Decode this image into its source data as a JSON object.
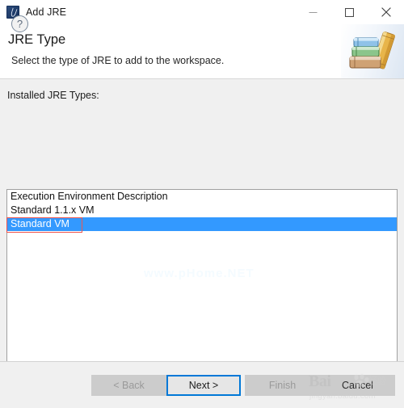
{
  "window": {
    "title": "Add JRE",
    "icon": "jre-icon",
    "controls": {
      "minimize": "minimize-icon",
      "maximize": "maximize-icon",
      "close": "close-icon"
    }
  },
  "header": {
    "title": "JRE Type",
    "subtitle": "Select the type of JRE to add to the workspace.",
    "banner_icon": "books-icon"
  },
  "main": {
    "list_label": "Installed JRE Types:",
    "list_items": [
      {
        "label": "Execution Environment Description",
        "selected": false
      },
      {
        "label": "Standard 1.1.x VM",
        "selected": false
      },
      {
        "label": "Standard VM",
        "selected": true
      }
    ],
    "selection_color": "#3399ff",
    "annotation_color": "#f0544c",
    "watermark": "www.pHome.NET"
  },
  "footer": {
    "help_label": "?",
    "buttons": [
      {
        "id": "back",
        "label": "< Back",
        "enabled": false,
        "focused": false
      },
      {
        "id": "next",
        "label": "Next >",
        "enabled": true,
        "focused": true
      },
      {
        "id": "finish",
        "label": "Finish",
        "enabled": false,
        "focused": false
      },
      {
        "id": "cancel",
        "label": "Cancel",
        "enabled": true,
        "focused": false
      }
    ]
  },
  "overlay_watermark": {
    "logo": "Bai",
    "logo_suffix": "du",
    "cn_text": "经验",
    "url": "jingyan.baidu.com"
  }
}
